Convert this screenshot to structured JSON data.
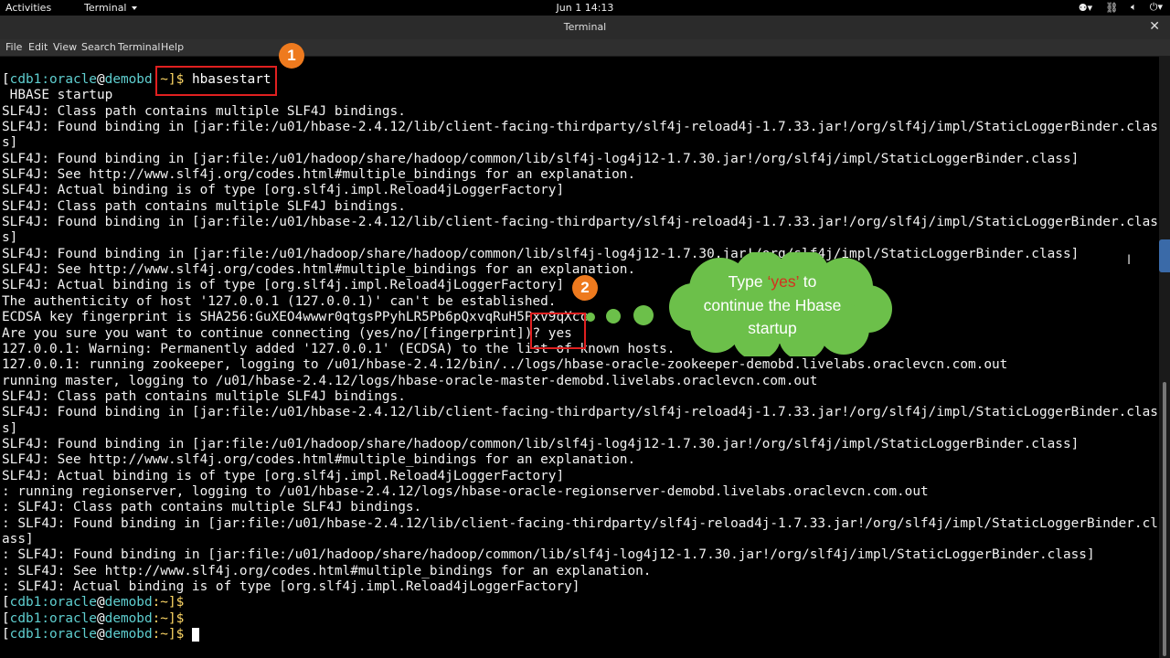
{
  "topbar": {
    "activities": "Activities",
    "app_menu": "Terminal",
    "clock": "Jun 1  14:13",
    "tray": [
      "accessibility-icon",
      "network-icon",
      "volume-icon",
      "power-icon"
    ]
  },
  "window": {
    "title": "Terminal",
    "close": "✕"
  },
  "menubar": {
    "items": [
      "File",
      "Edit",
      "View",
      "Search",
      "Terminal",
      "Help"
    ]
  },
  "terminal": {
    "prompt": {
      "user": "cdb1:oracle",
      "at": "@",
      "host": "demobd",
      "path": ":~]$"
    },
    "command": " hbasestart",
    "lines": [
      " HBASE startup",
      "SLF4J: Class path contains multiple SLF4J bindings.",
      "SLF4J: Found binding in [jar:file:/u01/hbase-2.4.12/lib/client-facing-thirdparty/slf4j-reload4j-1.7.33.jar!/org/slf4j/impl/StaticLoggerBinder.clas",
      "s]",
      "SLF4J: Found binding in [jar:file:/u01/hadoop/share/hadoop/common/lib/slf4j-log4j12-1.7.30.jar!/org/slf4j/impl/StaticLoggerBinder.class]",
      "SLF4J: See http://www.slf4j.org/codes.html#multiple_bindings for an explanation.",
      "SLF4J: Actual binding is of type [org.slf4j.impl.Reload4jLoggerFactory]",
      "SLF4J: Class path contains multiple SLF4J bindings.",
      "SLF4J: Found binding in [jar:file:/u01/hbase-2.4.12/lib/client-facing-thirdparty/slf4j-reload4j-1.7.33.jar!/org/slf4j/impl/StaticLoggerBinder.clas",
      "s]",
      "SLF4J: Found binding in [jar:file:/u01/hadoop/share/hadoop/common/lib/slf4j-log4j12-1.7.30.jar!/org/slf4j/impl/StaticLoggerBinder.class]",
      "SLF4J: See http://www.slf4j.org/codes.html#multiple_bindings for an explanation.",
      "SLF4J: Actual binding is of type [org.slf4j.impl.Reload4jLoggerFactory]",
      "The authenticity of host '127.0.0.1 (127.0.0.1)' can't be established.",
      "ECDSA key fingerprint is SHA256:GuXEO4wwwr0qtgsPPyhLR5Pb6pQxvqRuH5Pxv9qXcc.",
      "Are you sure you want to continue connecting (yes/no/[fingerprint])? yes",
      "127.0.0.1: Warning: Permanently added '127.0.0.1' (ECDSA) to the list of known hosts.",
      "127.0.0.1: running zookeeper, logging to /u01/hbase-2.4.12/bin/../logs/hbase-oracle-zookeeper-demobd.livelabs.oraclevcn.com.out",
      "running master, logging to /u01/hbase-2.4.12/logs/hbase-oracle-master-demobd.livelabs.oraclevcn.com.out",
      "SLF4J: Class path contains multiple SLF4J bindings.",
      "SLF4J: Found binding in [jar:file:/u01/hbase-2.4.12/lib/client-facing-thirdparty/slf4j-reload4j-1.7.33.jar!/org/slf4j/impl/StaticLoggerBinder.clas",
      "s]",
      "SLF4J: Found binding in [jar:file:/u01/hadoop/share/hadoop/common/lib/slf4j-log4j12-1.7.30.jar!/org/slf4j/impl/StaticLoggerBinder.class]",
      "SLF4J: See http://www.slf4j.org/codes.html#multiple_bindings for an explanation.",
      "SLF4J: Actual binding is of type [org.slf4j.impl.Reload4jLoggerFactory]",
      ": running regionserver, logging to /u01/hbase-2.4.12/logs/hbase-oracle-regionserver-demobd.livelabs.oraclevcn.com.out",
      ": SLF4J: Class path contains multiple SLF4J bindings.",
      ": SLF4J: Found binding in [jar:file:/u01/hbase-2.4.12/lib/client-facing-thirdparty/slf4j-reload4j-1.7.33.jar!/org/slf4j/impl/StaticLoggerBinder.cl",
      "ass]",
      ": SLF4J: Found binding in [jar:file:/u01/hadoop/share/hadoop/common/lib/slf4j-log4j12-1.7.30.jar!/org/slf4j/impl/StaticLoggerBinder.class]",
      ": SLF4J: See http://www.slf4j.org/codes.html#multiple_bindings for an explanation.",
      ": SLF4J: Actual binding is of type [org.slf4j.impl.Reload4jLoggerFactory]"
    ],
    "trailing_prompts": 3
  },
  "annotations": {
    "step1": "1",
    "step2": "2",
    "callout": {
      "pre": "Type ",
      "keyword": "‘yes’",
      "post": " to continue the Hbase startup"
    },
    "colors": {
      "highlight": "#e02020",
      "badge": "#ee7a1e",
      "cloud": "#6cc04a",
      "keyword": "#d62f1f"
    }
  }
}
